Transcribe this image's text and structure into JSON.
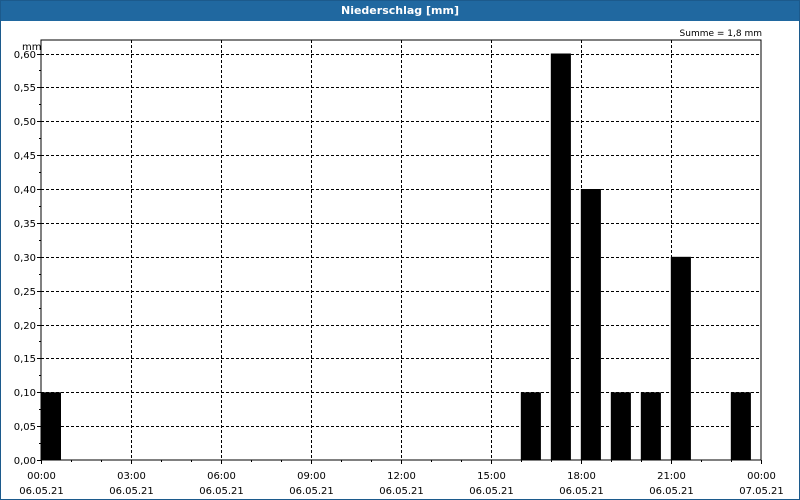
{
  "window": {
    "title": "Niederschlag [mm]"
  },
  "colors": {
    "titlebar": "#2068a0",
    "bar": "#000000",
    "grid": "#000000",
    "background": "#ffffff"
  },
  "chart_data": {
    "type": "bar",
    "title": "Niederschlag [mm]",
    "ylabel": "mm",
    "annotation": "Summe = 1,8 mm",
    "grid": true,
    "ylim": [
      0,
      0.62
    ],
    "yticks": [
      "0,00",
      "0,05",
      "0,10",
      "0,15",
      "0,20",
      "0,25",
      "0,30",
      "0,35",
      "0,40",
      "0,45",
      "0,50",
      "0,55",
      "0,60"
    ],
    "xlim_hours": [
      0,
      24
    ],
    "xticks": [
      {
        "hour": 0,
        "time": "00:00",
        "date": "06.05.21"
      },
      {
        "hour": 3,
        "time": "03:00",
        "date": "06.05.21"
      },
      {
        "hour": 6,
        "time": "06:00",
        "date": "06.05.21"
      },
      {
        "hour": 9,
        "time": "09:00",
        "date": "06.05.21"
      },
      {
        "hour": 12,
        "time": "12:00",
        "date": "06.05.21"
      },
      {
        "hour": 15,
        "time": "15:00",
        "date": "06.05.21"
      },
      {
        "hour": 18,
        "time": "18:00",
        "date": "06.05.21"
      },
      {
        "hour": 21,
        "time": "21:00",
        "date": "06.05.21"
      },
      {
        "hour": 24,
        "time": "00:00",
        "date": "07.05.21"
      }
    ],
    "bar_width_hours": 0.67,
    "series": [
      {
        "points": [
          {
            "hour": 0.33,
            "value": 0.1
          },
          {
            "hour": 16.33,
            "value": 0.1
          },
          {
            "hour": 17.33,
            "value": 0.6
          },
          {
            "hour": 18.33,
            "value": 0.4
          },
          {
            "hour": 19.33,
            "value": 0.1
          },
          {
            "hour": 20.33,
            "value": 0.1
          },
          {
            "hour": 21.33,
            "value": 0.3
          },
          {
            "hour": 23.33,
            "value": 0.1
          }
        ]
      }
    ]
  }
}
